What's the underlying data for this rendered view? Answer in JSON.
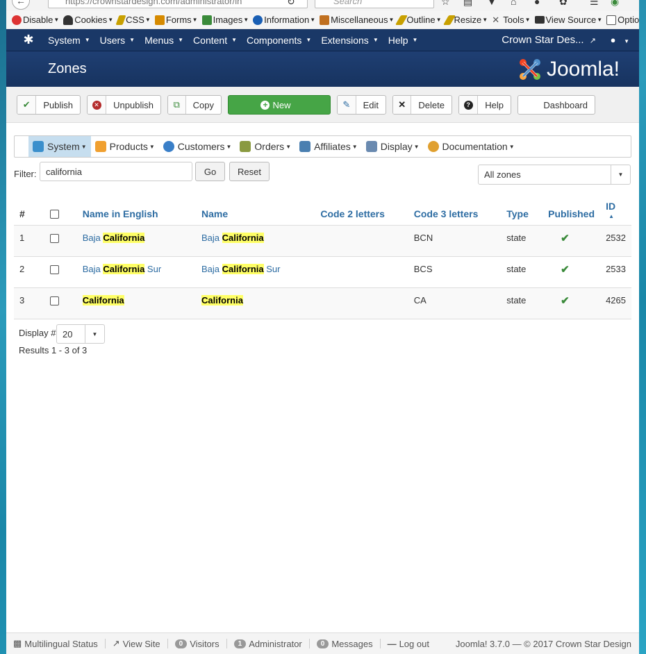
{
  "browser": {
    "url": "https://crownstardesign.com/administrator/in",
    "search_placeholder": "Search"
  },
  "webdev_toolbar": [
    {
      "label": "Disable",
      "color": "#d33"
    },
    {
      "label": "Cookies",
      "color": "#333"
    },
    {
      "label": "CSS",
      "color": "#c8a000"
    },
    {
      "label": "Forms",
      "color": "#d68a00"
    },
    {
      "label": "Images",
      "color": "#3a8a3a"
    },
    {
      "label": "Information",
      "color": "#1a5fb4"
    },
    {
      "label": "Miscellaneous",
      "color": "#c07020"
    },
    {
      "label": "Outline",
      "color": "#c8a000"
    },
    {
      "label": "Resize",
      "color": "#c8a000"
    },
    {
      "label": "Tools",
      "color": "#555"
    },
    {
      "label": "View Source",
      "color": "#333"
    },
    {
      "label": "Options",
      "color": "#555"
    }
  ],
  "topnav": {
    "menus": [
      "System",
      "Users",
      "Menus",
      "Content",
      "Components",
      "Extensions",
      "Help"
    ],
    "site_name": "Crown Star Des...",
    "user_menu": "user-icon"
  },
  "header": {
    "title": "Zones",
    "brand": "Joomla!"
  },
  "toolbar": {
    "publish": "Publish",
    "unpublish": "Unpublish",
    "copy": "Copy",
    "new": "New",
    "edit": "Edit",
    "delete": "Delete",
    "help": "Help",
    "dashboard": "Dashboard"
  },
  "component_menu": [
    {
      "label": "System",
      "color": "#3a8fcc"
    },
    {
      "label": "Products",
      "color": "#f0a030"
    },
    {
      "label": "Customers",
      "color": "#3a7fc8"
    },
    {
      "label": "Orders",
      "color": "#8a9a40"
    },
    {
      "label": "Affiliates",
      "color": "#4a7fb0"
    },
    {
      "label": "Display",
      "color": "#6a8ab0"
    },
    {
      "label": "Documentation",
      "color": "#e0a030"
    }
  ],
  "filter": {
    "label": "Filter:",
    "value": "california",
    "go": "Go",
    "reset": "Reset",
    "zone_select": "All zones"
  },
  "table": {
    "headers": {
      "num": "#",
      "name_en": "Name in English",
      "name": "Name",
      "code2": "Code 2 letters",
      "code3": "Code 3 letters",
      "type": "Type",
      "published": "Published",
      "id": "ID"
    },
    "rows": [
      {
        "num": "1",
        "name_en_pre": "Baja ",
        "name_en_hl": "California",
        "name_en_post": "",
        "name_pre": "Baja ",
        "name_hl": "California",
        "name_post": "",
        "code2": "",
        "code3": "BCN",
        "type": "state",
        "id": "2532"
      },
      {
        "num": "2",
        "name_en_pre": "Baja ",
        "name_en_hl": "California",
        "name_en_post": " Sur",
        "name_pre": "Baja ",
        "name_hl": "California",
        "name_post": " Sur",
        "code2": "",
        "code3": "BCS",
        "type": "state",
        "id": "2533"
      },
      {
        "num": "3",
        "name_en_pre": "",
        "name_en_hl": "California",
        "name_en_post": "",
        "name_pre": "",
        "name_hl": "California",
        "name_post": "",
        "code2": "",
        "code3": "CA",
        "type": "state",
        "id": "4265"
      }
    ]
  },
  "pagination": {
    "display_label": "Display #",
    "display_value": "20",
    "results": "Results 1 - 3 of 3"
  },
  "statusbar": {
    "multilingual": "Multilingual Status",
    "view_site": "View Site",
    "visitors_count": "0",
    "visitors": "Visitors",
    "admin_count": "1",
    "admin": "Administrator",
    "messages_count": "0",
    "messages": "Messages",
    "logout": "Log out",
    "version": "Joomla! 3.7.0 — © 2017 Crown Star Design"
  }
}
